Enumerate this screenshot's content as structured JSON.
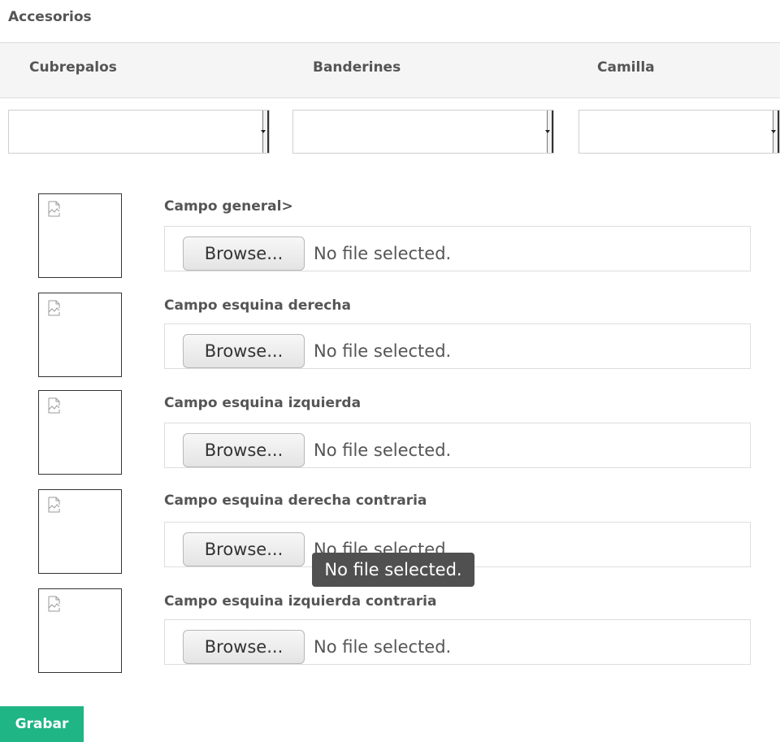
{
  "section_title": "Accesorios",
  "columns": [
    "Cubrepalos",
    "Banderines",
    "Camilla"
  ],
  "selects": [
    {
      "value": ""
    },
    {
      "value": ""
    },
    {
      "value": ""
    }
  ],
  "fields": [
    {
      "label": "Campo general>",
      "browse_label": "Browse...",
      "status": "No file selected."
    },
    {
      "label": "Campo esquina derecha",
      "browse_label": "Browse...",
      "status": "No file selected."
    },
    {
      "label": "Campo esquina izquierda",
      "browse_label": "Browse...",
      "status": "No file selected."
    },
    {
      "label": "Campo esquina derecha contraria",
      "browse_label": "Browse...",
      "status": "No file selected."
    },
    {
      "label": "Campo esquina izquierda contraria",
      "browse_label": "Browse...",
      "status": "No file selected."
    }
  ],
  "tooltip": "No file selected.",
  "save_button": "Grabar",
  "colors": {
    "accent": "#1fb585",
    "tooltip_bg": "#505050",
    "header_bg": "#f5f5f5"
  }
}
